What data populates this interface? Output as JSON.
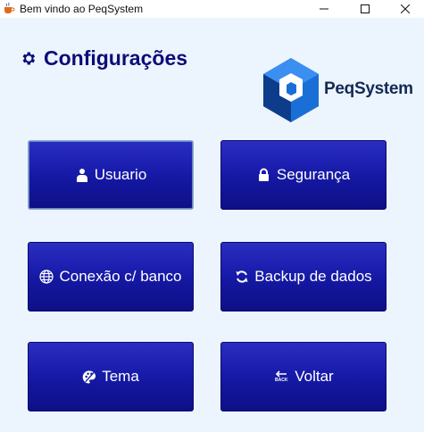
{
  "window": {
    "title": "Bem vindo ao PeqSystem",
    "icon": "java-cup-icon",
    "controls": [
      "minimize",
      "maximize",
      "close"
    ]
  },
  "header": {
    "title": "Configurações",
    "icon": "gear-icon"
  },
  "logo": {
    "text": "PeqSystem",
    "colors": {
      "primary": "#1a6fd6",
      "dark": "#0d3c8a",
      "text": "#132a55"
    }
  },
  "buttons": {
    "usuario": {
      "label": "Usuario",
      "icon": "user-icon"
    },
    "seguranca": {
      "label": "Segurança",
      "icon": "lock-icon"
    },
    "conexao": {
      "label": "Conexão c/ banco",
      "icon": "globe-icon"
    },
    "backup": {
      "label": "Backup de dados",
      "icon": "sync-icon"
    },
    "tema": {
      "label": "Tema",
      "icon": "palette-icon"
    },
    "voltar": {
      "label": "Voltar",
      "icon": "back-arrow-icon",
      "icon_text": "BACK"
    }
  },
  "colors": {
    "background": "#ecf5fd",
    "button": "#1418a2",
    "heading": "#0c0c78"
  }
}
